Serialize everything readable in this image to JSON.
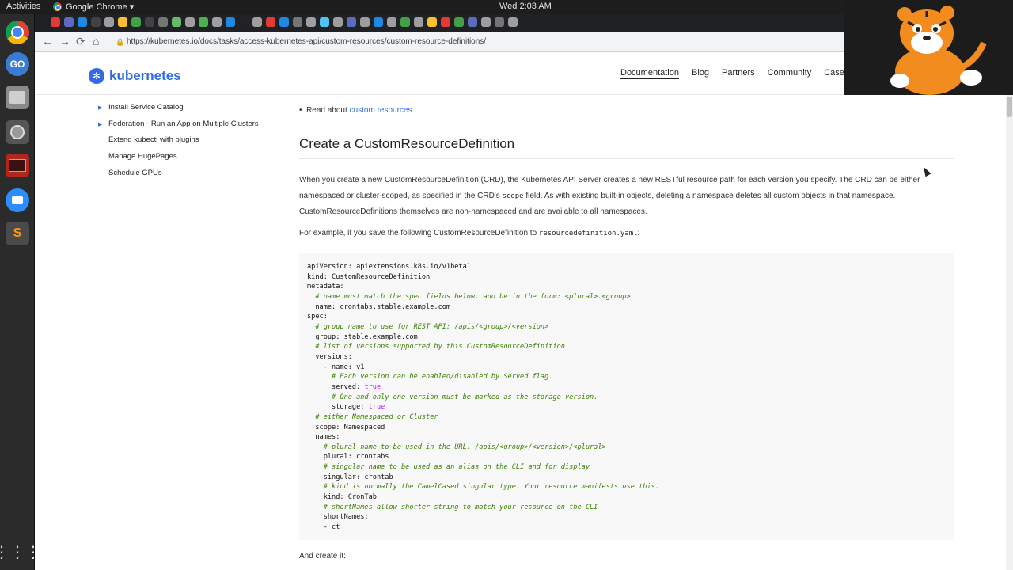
{
  "system": {
    "activities_label": "Activities",
    "app_menu_label": "Google Chrome ▾",
    "clock": "Wed  2:03 AM",
    "launcher_icon": "grid-icon"
  },
  "browser": {
    "url": "https://kubernetes.io/docs/tasks/access-kubernetes-api/custom-resources/custom-resource-definitions/",
    "back_icon": "←",
    "forward_icon": "→",
    "reload_icon": "⟳",
    "home_icon": "⌂"
  },
  "site": {
    "logo_text": "kubernetes",
    "nav": [
      "Documentation",
      "Blog",
      "Partners",
      "Community",
      "Case Studies"
    ]
  },
  "sidebar": {
    "items": [
      {
        "label": "Install Service Catalog",
        "expandable": true
      },
      {
        "label": "Federation - Run an App on Multiple Clusters",
        "expandable": true
      },
      {
        "label": "Extend kubectl with plugins",
        "expandable": false
      },
      {
        "label": "Manage HugePages",
        "expandable": false
      },
      {
        "label": "Schedule GPUs",
        "expandable": false
      }
    ]
  },
  "content": {
    "bullet_prefix": "Read about ",
    "bullet_link": "custom resources",
    "bullet_suffix": ".",
    "heading": "Create a CustomResourceDefinition",
    "intro_1": "When you create a new CustomResourceDefinition (CRD), the Kubernetes API Server creates a new RESTful resource path for each version you specify. The CRD can be either",
    "intro_2a": "namespaced or cluster-scoped, as specified in the CRD's ",
    "intro_2_code": "scope",
    "intro_2b": " field. As with existing built-in objects, deleting a namespace deletes all custom objects in that namespace.",
    "intro_3": "CustomResourceDefinitions themselves are non-namespaced and are available to all namespaces.",
    "example_prefix": "For example, if you save the following CustomResourceDefinition to ",
    "example_code": "resourcedefinition.yaml",
    "example_suffix": ":",
    "code_lines": [
      {
        "text": "apiVersion: apiextensions.k8s.io/v1beta1",
        "type": "plain"
      },
      {
        "text": "kind: CustomResourceDefinition",
        "type": "plain"
      },
      {
        "text": "metadata:",
        "type": "plain"
      },
      {
        "text": "  # name must match the spec fields below, and be in the form: <plural>.<group>",
        "type": "comment"
      },
      {
        "text": "  name: crontabs.stable.example.com",
        "type": "plain"
      },
      {
        "text": "spec:",
        "type": "plain"
      },
      {
        "text": "  # group name to use for REST API: /apis/<group>/<version>",
        "type": "comment"
      },
      {
        "text": "  group: stable.example.com",
        "type": "plain"
      },
      {
        "text": "  # list of versions supported by this CustomResourceDefinition",
        "type": "comment"
      },
      {
        "text": "  versions:",
        "type": "plain"
      },
      {
        "text": "    - name: v1",
        "type": "plain"
      },
      {
        "text": "      # Each version can be enabled/disabled by Served flag.",
        "type": "comment"
      },
      {
        "text": "      served: ",
        "type": "plain",
        "keyword": "true"
      },
      {
        "text": "      # One and only one version must be marked as the storage version.",
        "type": "comment"
      },
      {
        "text": "      storage: ",
        "type": "plain",
        "keyword": "true"
      },
      {
        "text": "  # either Namespaced or Cluster",
        "type": "comment"
      },
      {
        "text": "  scope: Namespaced",
        "type": "plain"
      },
      {
        "text": "  names:",
        "type": "plain"
      },
      {
        "text": "    # plural name to be used in the URL: /apis/<group>/<version>/<plural>",
        "type": "comment"
      },
      {
        "text": "    plural: crontabs",
        "type": "plain"
      },
      {
        "text": "    # singular name to be used as an alias on the CLI and for display",
        "type": "comment"
      },
      {
        "text": "    singular: crontab",
        "type": "plain"
      },
      {
        "text": "    # kind is normally the CamelCased singular type. Your resource manifests use this.",
        "type": "comment"
      },
      {
        "text": "    kind: CronTab",
        "type": "plain"
      },
      {
        "text": "    # shortNames allow shorter string to match your resource on the CLI",
        "type": "comment"
      },
      {
        "text": "    shortNames:",
        "type": "plain"
      },
      {
        "text": "    - ct",
        "type": "plain"
      }
    ],
    "after_code": "And create it:"
  },
  "colors": {
    "accent": "#326ce5",
    "comment": "#3a7f00",
    "keyword": "#aa22ff"
  }
}
